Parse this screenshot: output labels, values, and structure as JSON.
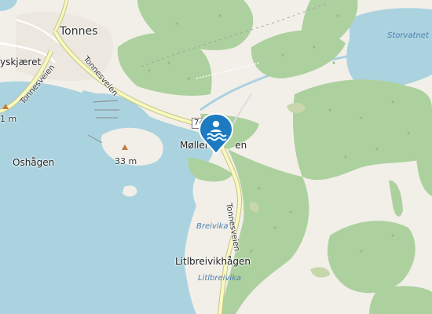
{
  "map": {
    "marker": {
      "icon": "swimming-icon",
      "color": "#1e7ac0"
    },
    "places": {
      "tonnes": "Tonnes",
      "yskjaeret": "yskjæret",
      "oshagen": "Oshågen",
      "mollelv": "Møllelv",
      "mollelv_suffix": "en",
      "litlbreivikhagen": "Litlbreivikhågen"
    },
    "water": {
      "storvatnet": "Storvatnet",
      "breivika": "Breivika",
      "litlbreivika": "Litlbreivika"
    },
    "roads": {
      "tonnesveien_1": "Tonnesveien",
      "tonnesveien_2": "Tonnesveien",
      "tonnesveien_3": "Tonnesveien",
      "route_number": "74"
    },
    "elevations": {
      "peak_33": "33 m",
      "peak_left": "1 m"
    },
    "colors": {
      "sea": "#aad3df",
      "forest": "#add19e",
      "land": "#f2efe9",
      "road": "#f7fabf",
      "road_casing": "#c9c18a",
      "marker": "#1e7ac0"
    }
  }
}
